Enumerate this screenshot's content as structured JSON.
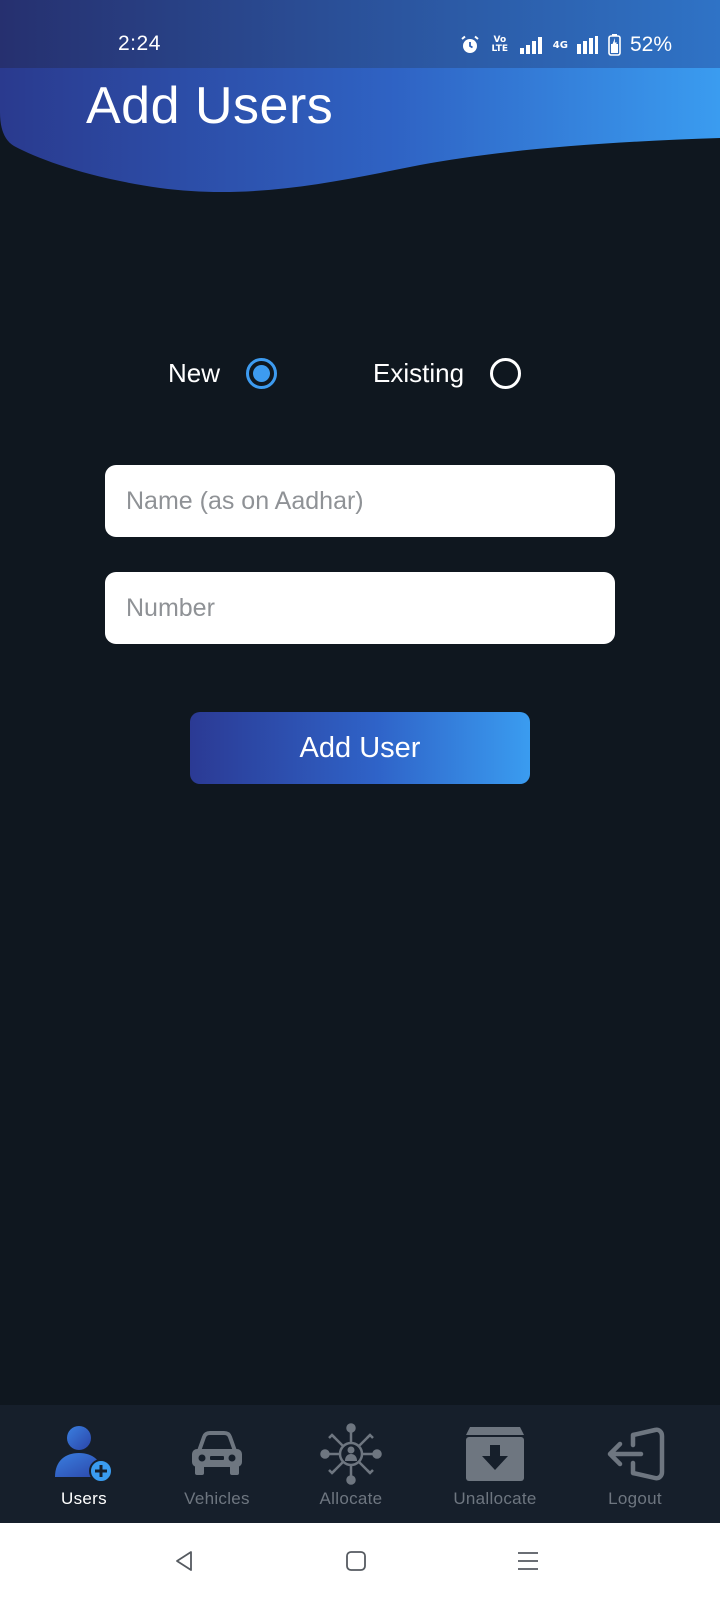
{
  "status_bar": {
    "time": "2:24",
    "volte_line1": "Vo",
    "volte_line2": "LTE",
    "network_type": "4G",
    "battery_percent": "52%"
  },
  "header": {
    "title": "Add Users",
    "gradient_start": "#2a3a8e",
    "gradient_end": "#3a9cf0"
  },
  "user_type": {
    "options": [
      {
        "label": "New",
        "selected": true
      },
      {
        "label": "Existing",
        "selected": false
      }
    ]
  },
  "form": {
    "name_placeholder": "Name (as on Aadhar)",
    "name_value": "",
    "number_placeholder": "Number",
    "number_value": "",
    "submit_label": "Add User"
  },
  "bottom_nav": {
    "items": [
      {
        "label": "Users",
        "icon": "user-add-icon",
        "active": true
      },
      {
        "label": "Vehicles",
        "icon": "car-icon",
        "active": false
      },
      {
        "label": "Allocate",
        "icon": "allocate-network-icon",
        "active": false
      },
      {
        "label": "Unallocate",
        "icon": "archive-download-icon",
        "active": false
      },
      {
        "label": "Logout",
        "icon": "logout-icon",
        "active": false
      }
    ]
  },
  "system_nav": {
    "buttons": [
      "back-icon",
      "home-icon",
      "recents-menu-icon"
    ]
  },
  "colors": {
    "background": "#0f171f",
    "accent": "#3d9bf0",
    "nav_background": "#161f2b",
    "nav_inactive": "#6e7680"
  }
}
